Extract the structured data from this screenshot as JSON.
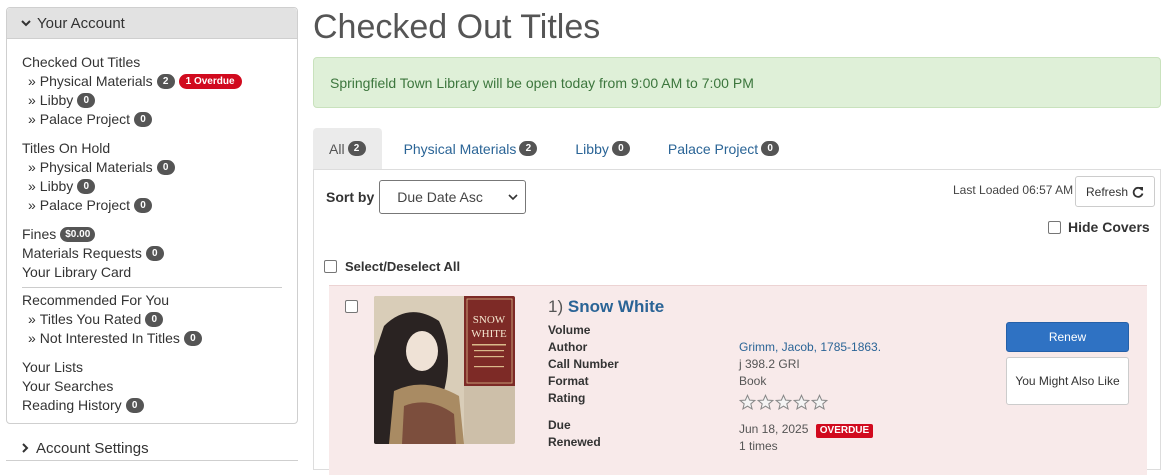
{
  "sidebar": {
    "account_header": "Your Account",
    "sections": {
      "checked_out": {
        "label": "Checked Out Titles",
        "items": [
          {
            "label": "Physical Materials",
            "count": "2",
            "extra_badge": "1 Overdue"
          },
          {
            "label": "Libby",
            "count": "0"
          },
          {
            "label": "Palace Project",
            "count": "0"
          }
        ]
      },
      "holds": {
        "label": "Titles On Hold",
        "items": [
          {
            "label": "Physical Materials",
            "count": "0"
          },
          {
            "label": "Libby",
            "count": "0"
          },
          {
            "label": "Palace Project",
            "count": "0"
          }
        ]
      },
      "fines": {
        "label": "Fines",
        "amount": "$0.00"
      },
      "materials_requests": {
        "label": "Materials Requests",
        "count": "0"
      },
      "library_card": {
        "label": "Your Library Card"
      },
      "recommended": {
        "label": "Recommended For You",
        "items": [
          {
            "label": "Titles You Rated",
            "count": "0"
          },
          {
            "label": "Not Interested In Titles",
            "count": "0"
          }
        ]
      },
      "lists": {
        "label": "Your Lists"
      },
      "searches": {
        "label": "Your Searches"
      },
      "reading_history": {
        "label": "Reading History",
        "count": "0"
      }
    },
    "raquo": "»",
    "settings_header": "Account Settings"
  },
  "main": {
    "title": "Checked Out Titles",
    "alert": "Springfield Town Library will be open today from 9:00 AM to 7:00 PM",
    "tabs": [
      {
        "label": "All",
        "count": "2",
        "active": true
      },
      {
        "label": "Physical Materials",
        "count": "2"
      },
      {
        "label": "Libby",
        "count": "0"
      },
      {
        "label": "Palace Project",
        "count": "0"
      }
    ],
    "sort_label": "Sort by",
    "sort_value": "Due Date Asc",
    "last_loaded": "Last Loaded 06:57 AM",
    "refresh_label": "Refresh",
    "hide_covers_label": "Hide Covers",
    "select_all_label": "Select/Deselect All",
    "item": {
      "index": "1)",
      "title": "Snow White",
      "cover_title_top": "SNOW",
      "cover_title_bottom": "WHITE",
      "labels": {
        "volume": "Volume",
        "author": "Author",
        "call_number": "Call Number",
        "format": "Format",
        "rating": "Rating",
        "due": "Due",
        "renewed": "Renewed"
      },
      "values": {
        "volume": "",
        "author": "Grimm, Jacob, 1785-1863.",
        "call_number": "j 398.2 GRI",
        "format": "Book",
        "rating": 0,
        "due": "Jun 18, 2025",
        "due_status": "OVERDUE",
        "renewed": "1 times"
      },
      "renew_label": "Renew",
      "might_like_label": "You Might Also Like"
    }
  },
  "colors": {
    "link": "#2a6496",
    "overdue": "#d10a1e",
    "primary_button": "#2f72c3",
    "alert_bg": "#dff0d8",
    "overdue_row_bg": "#f8eaea"
  }
}
